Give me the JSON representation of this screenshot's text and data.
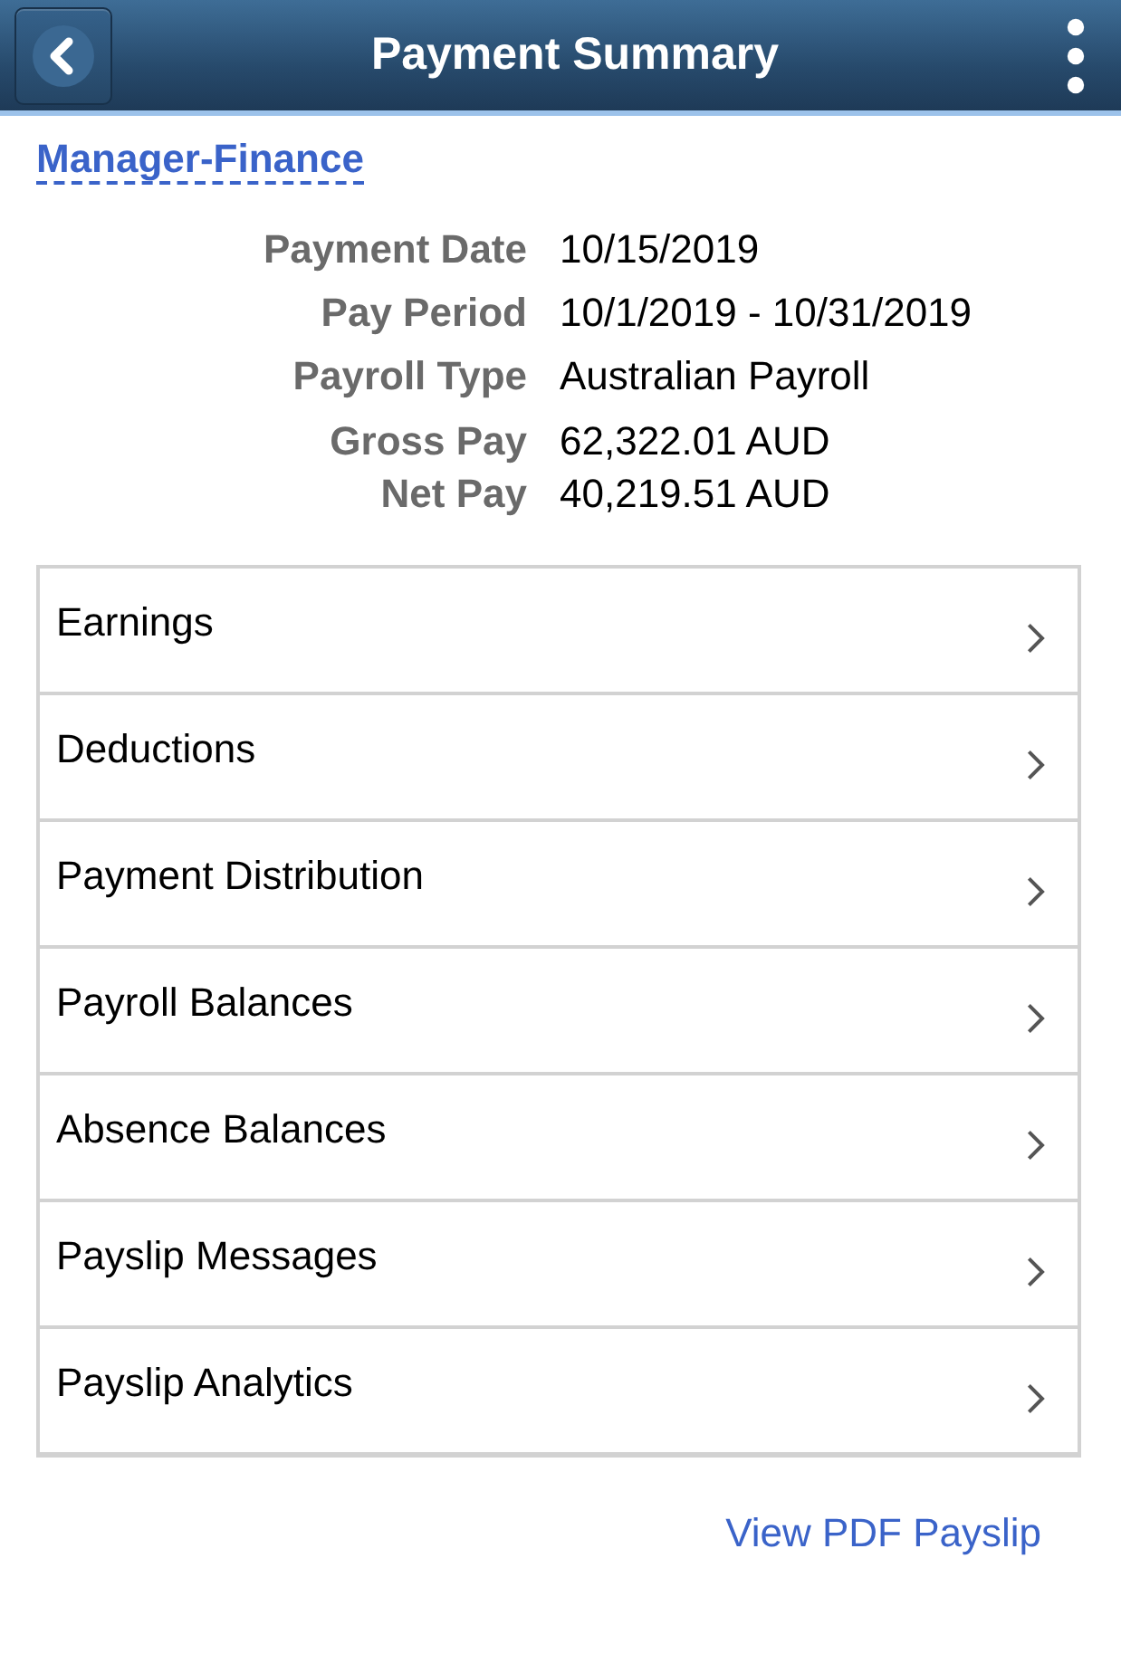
{
  "header": {
    "title": "Payment Summary"
  },
  "role_link": "Manager-Finance",
  "payment_details": [
    {
      "label": "Payment Date",
      "value": "10/15/2019"
    },
    {
      "label": "Pay Period",
      "value": "10/1/2019 - 10/31/2019"
    },
    {
      "label": "Payroll Type",
      "value": "Australian Payroll"
    }
  ],
  "pay_totals": [
    {
      "label": "Gross Pay",
      "value": "62,322.01 AUD"
    },
    {
      "label": "Net Pay",
      "value": "40,219.51 AUD"
    }
  ],
  "sections": [
    {
      "label": "Earnings"
    },
    {
      "label": "Deductions"
    },
    {
      "label": "Payment Distribution"
    },
    {
      "label": "Payroll Balances"
    },
    {
      "label": "Absence Balances"
    },
    {
      "label": "Payslip Messages"
    },
    {
      "label": "Payslip Analytics"
    }
  ],
  "footer_link": "View PDF Payslip"
}
